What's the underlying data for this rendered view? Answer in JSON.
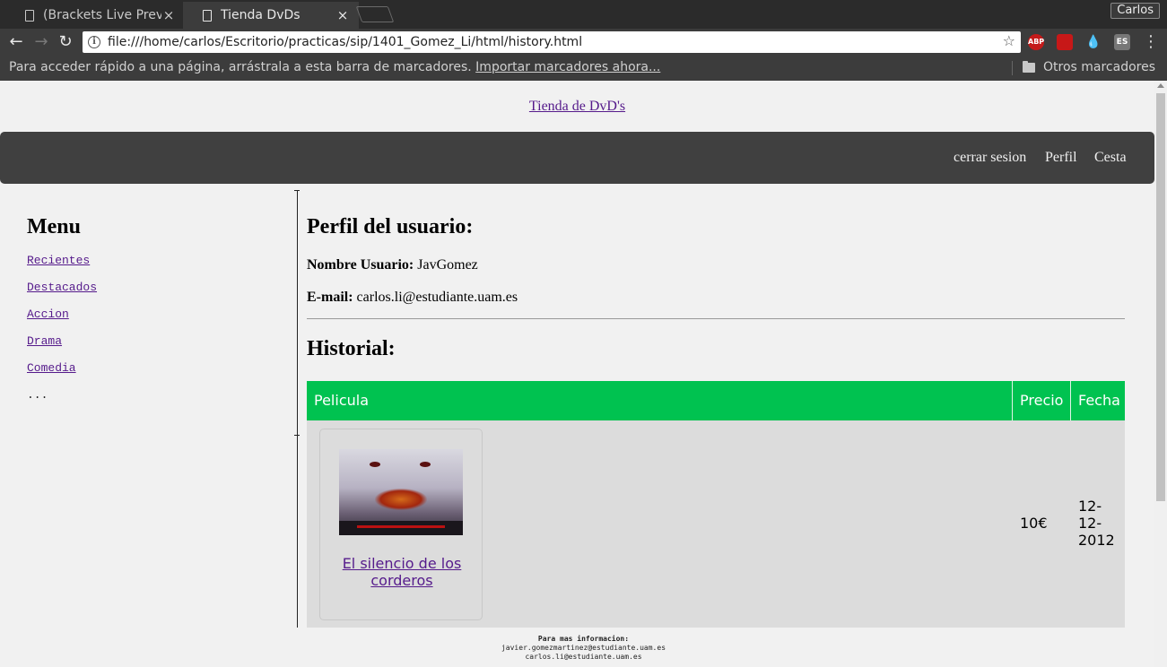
{
  "browser": {
    "tabs": [
      {
        "title": "(Brackets Live Prev",
        "active": false
      },
      {
        "title": "Tienda DvDs",
        "active": true
      }
    ],
    "profile_name": "Carlos",
    "url": "file:///home/carlos/Escritorio/practicas/sip/1401_Gomez_Li/html/history.html",
    "extensions": [
      "ABP",
      "ES"
    ],
    "bookmarks_bar": {
      "hint": "Para acceder rápido a una página, arrástrala a esta barra de marcadores.",
      "import_link": "Importar marcadores ahora...",
      "other_folder": "Otros marcadores"
    }
  },
  "page": {
    "site_title": "Tienda de DvD's",
    "navbar": {
      "logout": "cerrar sesion",
      "profile": "Perfil",
      "cart": "Cesta"
    },
    "sidebar": {
      "heading": "Menu",
      "items": [
        "Recientes",
        "Destacados",
        "Accion",
        "Drama",
        "Comedia"
      ],
      "more": "..."
    },
    "profile": {
      "heading": "Perfil del usuario:",
      "username_label": "Nombre Usuario:",
      "username_value": "JavGomez",
      "email_label": "E-mail:",
      "email_value": "carlos.li@estudiante.uam.es"
    },
    "history": {
      "heading": "Historial:",
      "columns": [
        "Pelicula",
        "Precio",
        "Fecha"
      ],
      "rows": [
        {
          "movie": "El silencio de los corderos",
          "price": "10€",
          "date": "12-12-2012"
        }
      ]
    },
    "footer": {
      "title": "Para mas informacion:",
      "emails": [
        "javier.gomezmartinez@estudiante.uam.es",
        "carlos.li@estudiante.uam.es"
      ]
    }
  },
  "colors": {
    "navbar_bg": "#404040",
    "table_header_bg": "#00c250",
    "row_bg": "#dcdcdc",
    "page_bg": "#f1f1f1",
    "link_visited": "#551a8b"
  }
}
